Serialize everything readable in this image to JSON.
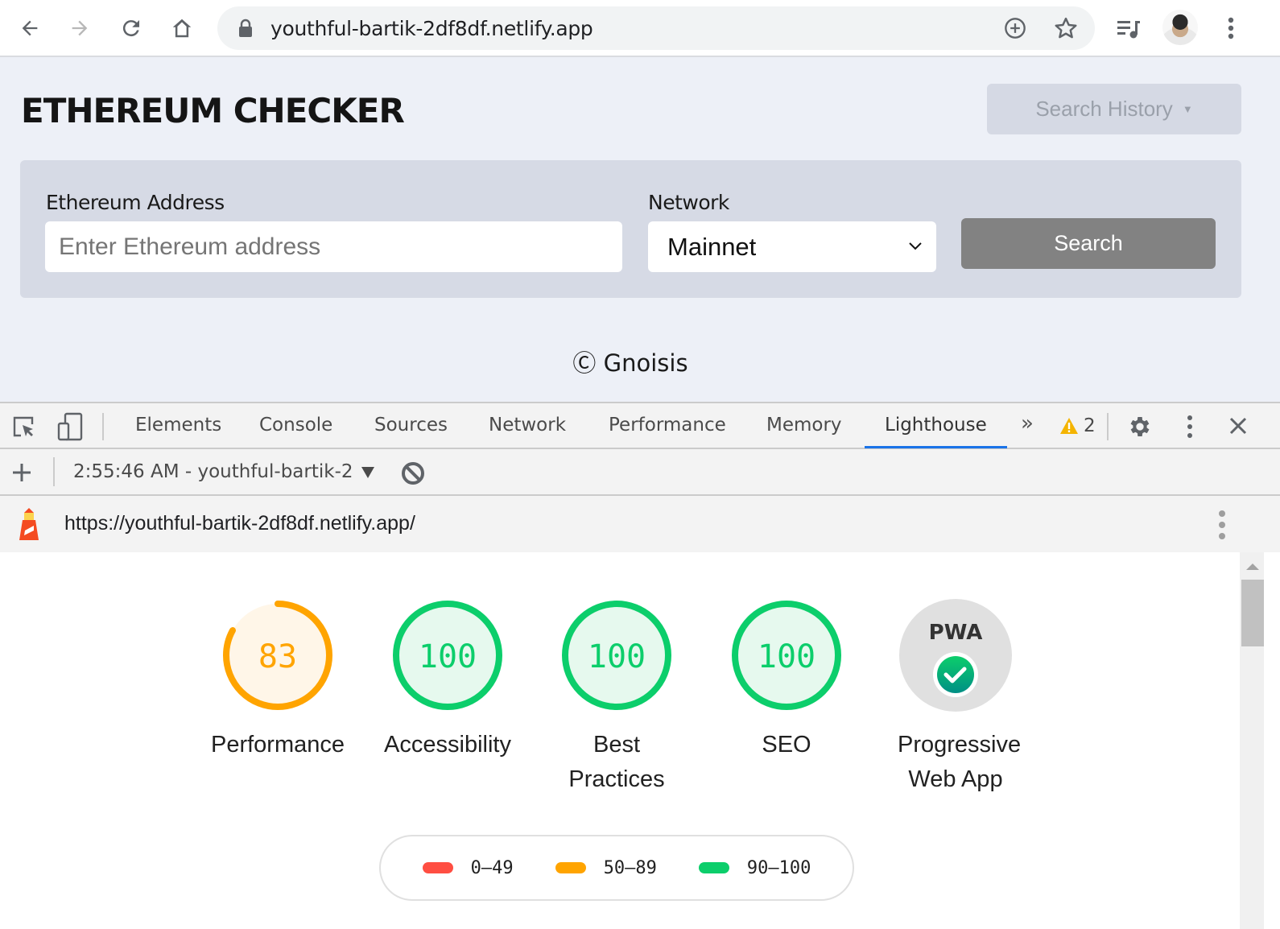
{
  "browser": {
    "url": "youthful-bartik-2df8df.netlify.app",
    "icons": [
      "back-arrow-icon",
      "forward-arrow-icon",
      "reload-icon",
      "home-icon",
      "lock-icon",
      "add-circle-icon",
      "star-icon",
      "media-queue-icon",
      "profile-avatar",
      "more-vert-icon"
    ]
  },
  "app": {
    "title": "ETHEREUM CHECKER",
    "search_history_label": "Search History",
    "search_history_caret": "▼",
    "address_label": "Ethereum Address",
    "address_placeholder": "Enter Ethereum address",
    "address_value": "",
    "network_label": "Network",
    "network_value": "Mainnet",
    "search_button": "Search",
    "footer": "Ⓒ Gnoisis"
  },
  "devtools": {
    "tabs": [
      {
        "label": "Elements"
      },
      {
        "label": "Console"
      },
      {
        "label": "Sources"
      },
      {
        "label": "Network"
      },
      {
        "label": "Performance"
      },
      {
        "label": "Memory"
      },
      {
        "label": "Lighthouse",
        "active": true
      }
    ],
    "more_tabs": "»",
    "warning_count": "2",
    "report_selector": "2:55:46 AM - youthful-bartik-2",
    "report_url": "https://youthful-bartik-2df8df.netlify.app/"
  },
  "lighthouse": {
    "gauges": [
      {
        "label": "Performance",
        "score": 83,
        "display": "83",
        "color": "#ffa400",
        "fill": "#fff6e8"
      },
      {
        "label": "Accessibility",
        "score": 100,
        "display": "100",
        "color": "#0cce6b",
        "fill": "#e6f9ee"
      },
      {
        "label": "Best Practices",
        "score": 100,
        "display": "100",
        "color": "#0cce6b",
        "fill": "#e6f9ee"
      },
      {
        "label": "SEO",
        "score": 100,
        "display": "100",
        "color": "#0cce6b",
        "fill": "#e6f9ee"
      }
    ],
    "pwa": {
      "label": "Progressive Web App",
      "badge": "PWA",
      "status": "pass"
    },
    "legend": [
      {
        "range": "0–49",
        "color": "#ff4e42"
      },
      {
        "range": "50–89",
        "color": "#ffa400"
      },
      {
        "range": "90–100",
        "color": "#0cce6b"
      }
    ]
  }
}
